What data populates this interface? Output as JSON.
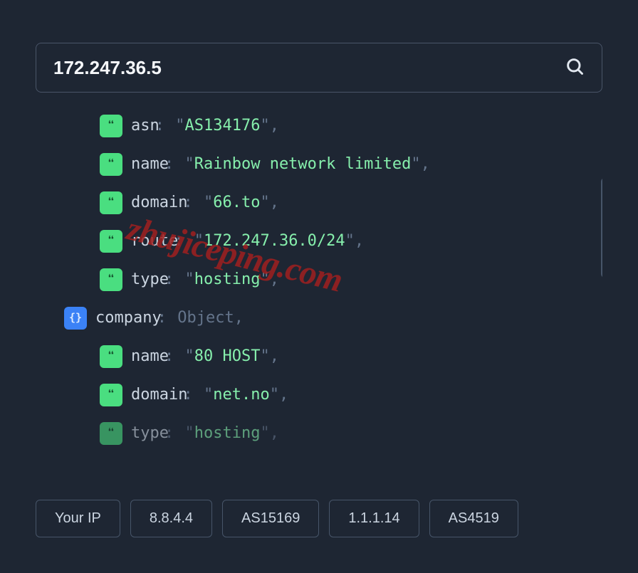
{
  "search": {
    "value": "172.247.36.5"
  },
  "json": {
    "rows": [
      {
        "indent": 2,
        "type": "string",
        "key": "asn",
        "value": "AS134176",
        "faded": false
      },
      {
        "indent": 2,
        "type": "string",
        "key": "name",
        "value": "Rainbow network limited",
        "faded": false
      },
      {
        "indent": 2,
        "type": "string",
        "key": "domain",
        "value": "66.to",
        "faded": false
      },
      {
        "indent": 2,
        "type": "string",
        "key": "route",
        "value": "172.247.36.0/24",
        "faded": false
      },
      {
        "indent": 2,
        "type": "string",
        "key": "type",
        "value": "hosting",
        "faded": false
      },
      {
        "indent": 1,
        "type": "object",
        "key": "company",
        "value": "Object",
        "faded": false
      },
      {
        "indent": 2,
        "type": "string",
        "key": "name",
        "value": "80 HOST",
        "faded": false
      },
      {
        "indent": 2,
        "type": "string",
        "key": "domain",
        "value": "net.no",
        "faded": false
      },
      {
        "indent": 2,
        "type": "string",
        "key": "type",
        "value": "hosting",
        "faded": true
      }
    ]
  },
  "quicklinks": {
    "items": [
      "Your IP",
      "8.8.4.4",
      "AS15169",
      "1.1.1.14",
      "AS4519"
    ]
  },
  "watermark": "zhujiceping.com"
}
